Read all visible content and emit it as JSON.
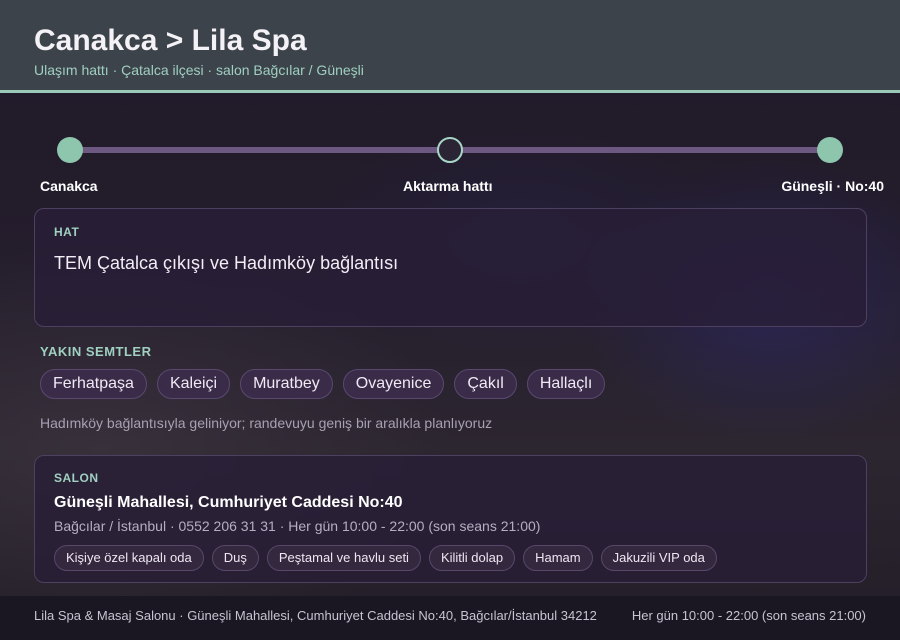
{
  "header": {
    "title": "Canakca > Lila Spa",
    "subtitle": "Ulaşım hattı · Çatalca ilçesi · salon Bağcılar / Güneşli"
  },
  "route_stops": [
    {
      "label": "Canakca"
    },
    {
      "label": "Aktarma hattı"
    },
    {
      "label": "Güneşli · No:40"
    }
  ],
  "route": {
    "caption": "HAT",
    "text": "TEM Çatalca çıkışı ve Hadımköy bağlantısı"
  },
  "nearby": {
    "caption": "YAKIN SEMTLER",
    "items": [
      "Ferhatpaşa",
      "Kaleiçi",
      "Muratbey",
      "Ovayenice",
      "Çakıl",
      "Hallaçlı"
    ],
    "note": "Hadımköy bağlantısıyla geliniyor; randevuyu geniş bir aralıkla planlıyoruz"
  },
  "salon": {
    "caption": "SALON",
    "name": "Güneşli Mahallesi, Cumhuriyet Caddesi No:40",
    "info": "Bağcılar / İstanbul · 0552 206 31 31 · Her gün 10:00 - 22:00 (son seans 21:00)",
    "amenities": [
      "Kişiye özel kapalı oda",
      "Duş",
      "Peştamal ve havlu seti",
      "Kilitli dolap",
      "Hamam",
      "Jakuzili VIP oda"
    ]
  },
  "footer": {
    "left": "Lila Spa & Masaj Salonu · Güneşli Mahallesi, Cumhuriyet Caddesi No:40, Bağcılar/İstanbul 34212",
    "right": "Her gün 10:00 - 22:00 (son seans 21:00)"
  },
  "colors": {
    "accent": "#9ccab8",
    "track": "#6c5880",
    "header_bg": "#3d434b"
  }
}
